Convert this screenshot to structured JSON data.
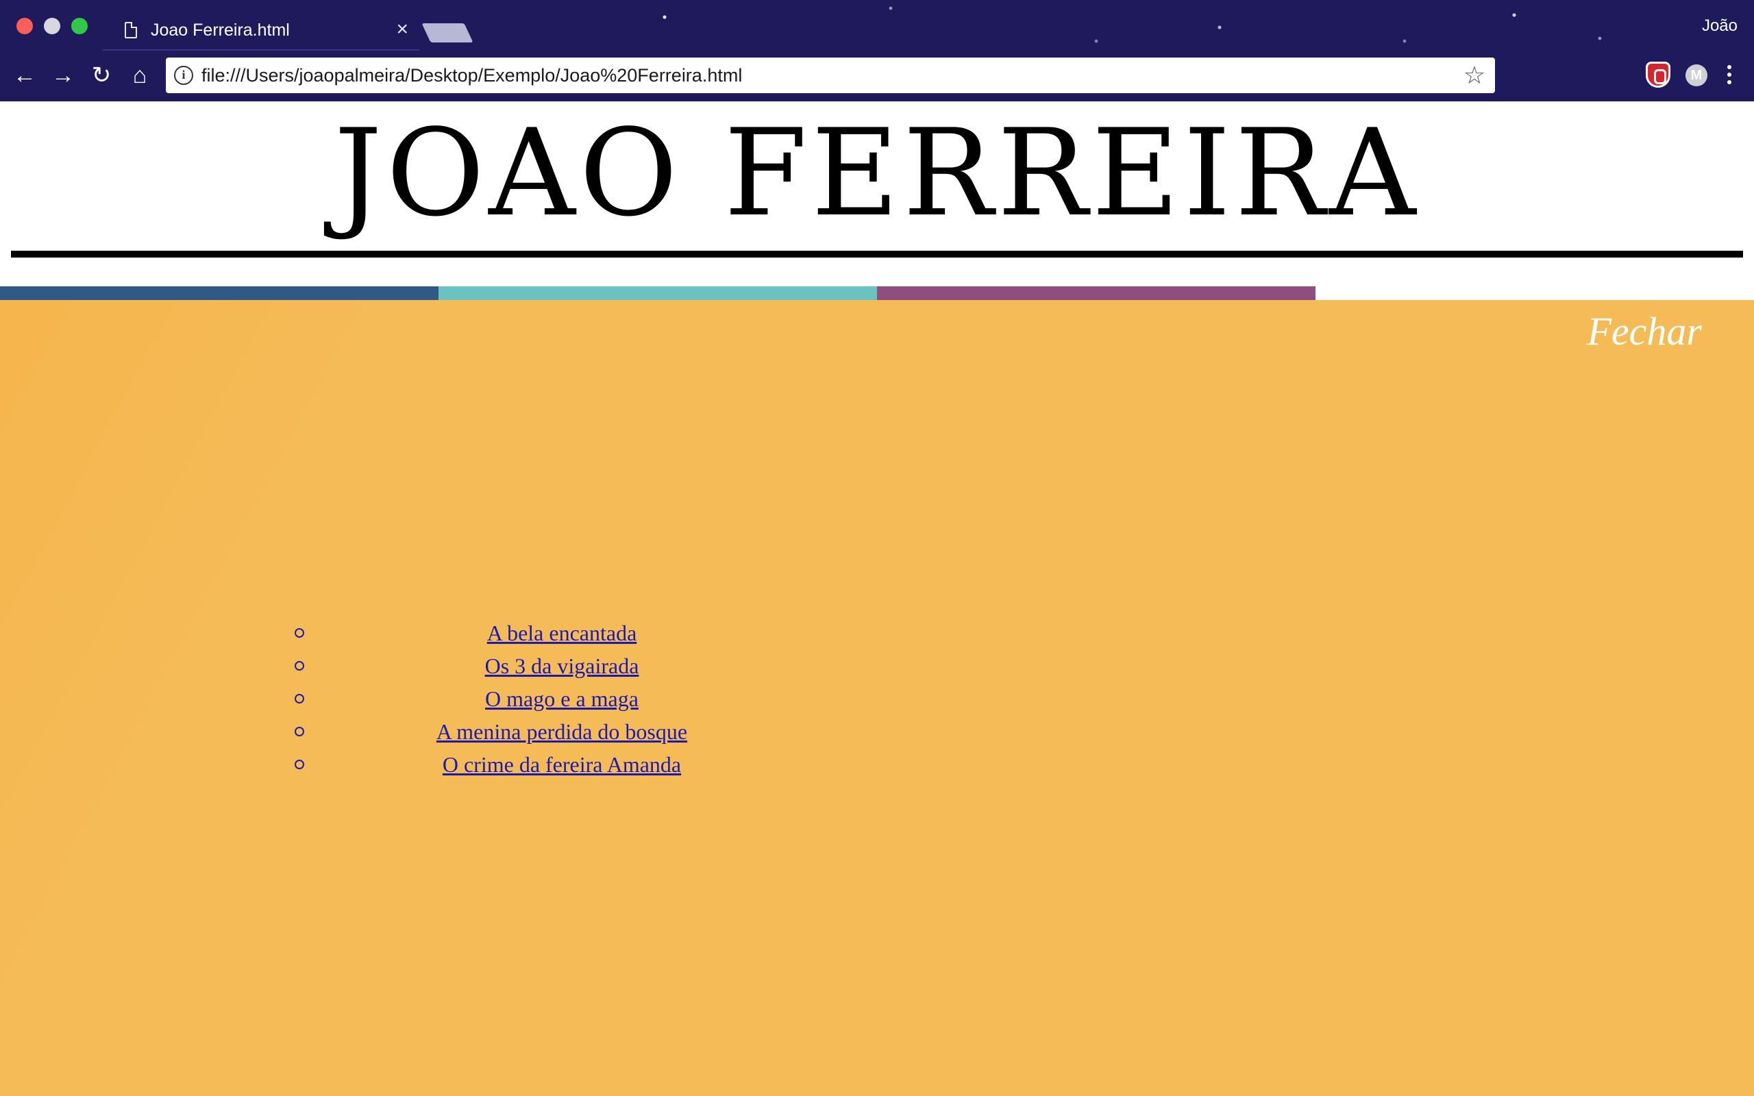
{
  "browser": {
    "tab_title": "Joao Ferreira.html",
    "tab_close": "×",
    "profile_name": "João",
    "url": "file:///Users/joaopalmeira/Desktop/Exemplo/Joao%20Ferreira.html",
    "nav": {
      "back": "←",
      "forward": "→",
      "reload": "↻",
      "home": "⌂"
    },
    "info_glyph": "i",
    "star_glyph": "☆",
    "ext_m_label": "M"
  },
  "page": {
    "title": "JOAO FERREIRA",
    "close_label": "Fechar",
    "color_bars": [
      "#2e5a85",
      "#6ac2c1",
      "#8e4f7f"
    ],
    "background": "#f5bb57",
    "link_color": "#1d1ab0",
    "stories": [
      "A bela encantada",
      "Os 3 da vigairada",
      "O mago e a maga",
      "A menina perdida do bosque",
      "O crime da fereira Amanda"
    ]
  }
}
